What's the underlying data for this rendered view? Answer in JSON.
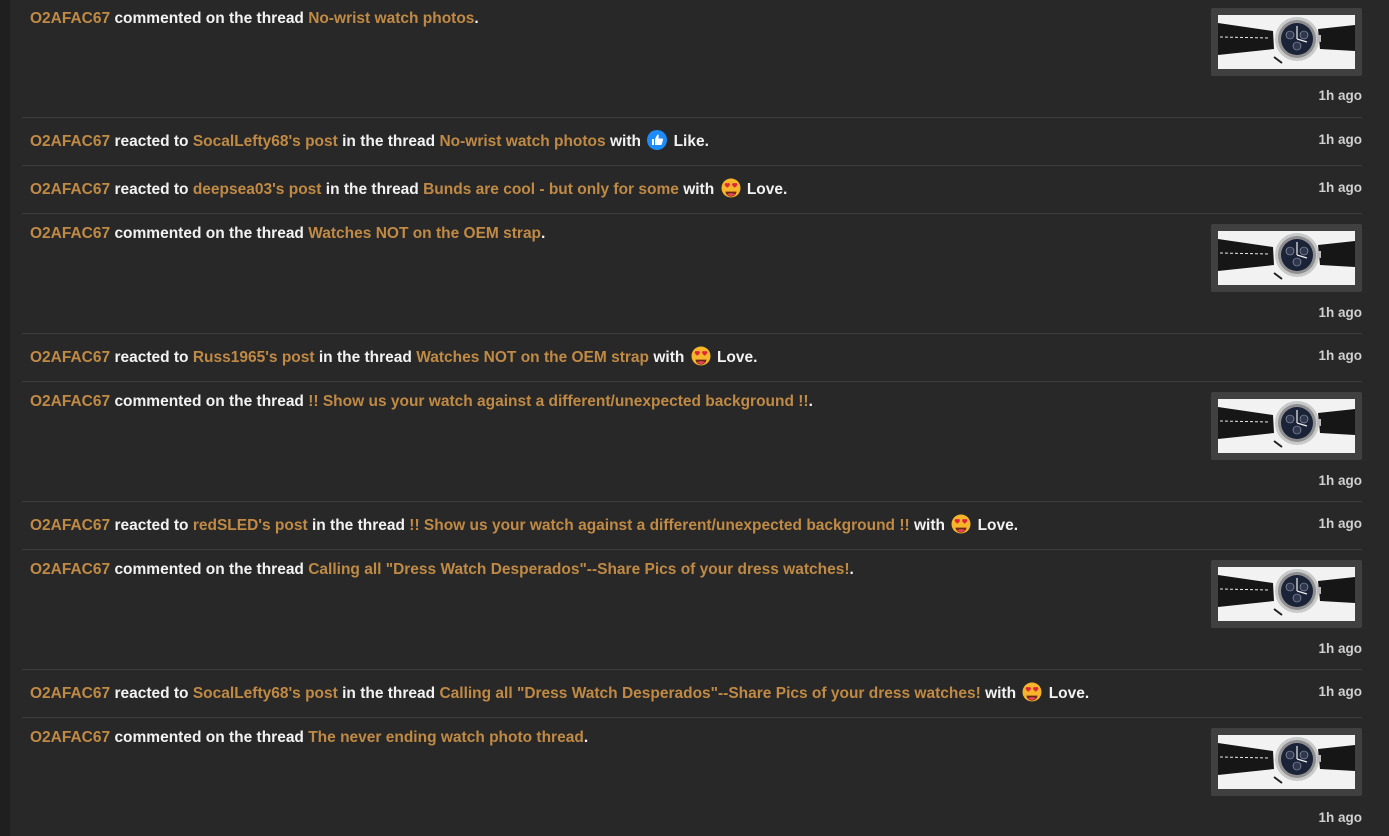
{
  "colors": {
    "background": "#282828",
    "link": "#c08a45",
    "text": "#f2f2f2",
    "divider": "#3c3c3c"
  },
  "items": [
    {
      "user": "O2AFAC67",
      "verb": "commented on the thread",
      "thread": "No-wrist watch photos",
      "end": ".",
      "time": "1h ago",
      "thumb_icon": "watch-photo-thumbnail"
    },
    {
      "user": "O2AFAC67",
      "verb": "reacted to",
      "post": "SocalLefty68's post",
      "mid": "in the thread",
      "thread": "No-wrist watch photos",
      "with": "with",
      "reaction_icon": "like-icon",
      "reaction": "Like.",
      "time": "1h ago"
    },
    {
      "user": "O2AFAC67",
      "verb": "reacted to",
      "post": "deepsea03's post",
      "mid": "in the thread",
      "thread": "Bunds are cool - but only for some",
      "with": "with",
      "reaction_icon": "love-icon",
      "reaction": "Love.",
      "time": "1h ago"
    },
    {
      "user": "O2AFAC67",
      "verb": "commented on the thread",
      "thread": "Watches NOT on the OEM strap",
      "end": ".",
      "time": "1h ago",
      "thumb_icon": "watch-photo-thumbnail"
    },
    {
      "user": "O2AFAC67",
      "verb": "reacted to",
      "post": "Russ1965's post",
      "mid": "in the thread",
      "thread": "Watches NOT on the OEM strap",
      "with": "with",
      "reaction_icon": "love-icon",
      "reaction": "Love.",
      "time": "1h ago"
    },
    {
      "user": "O2AFAC67",
      "verb": "commented on the thread",
      "thread": "!! Show us your watch against a different/unexpected background !!",
      "end": ".",
      "time": "1h ago",
      "thumb_icon": "watch-photo-thumbnail"
    },
    {
      "user": "O2AFAC67",
      "verb": "reacted to",
      "post": "redSLED's post",
      "mid": "in the thread",
      "thread": "!! Show us your watch against a different/unexpected background !!",
      "with": "with",
      "reaction_icon": "love-icon",
      "reaction": "Love.",
      "time": "1h ago"
    },
    {
      "user": "O2AFAC67",
      "verb": "commented on the thread",
      "thread": "Calling all \"Dress Watch Desperados\"--Share Pics of your dress watches!",
      "end": ".",
      "time": "1h ago",
      "thumb_icon": "watch-photo-thumbnail"
    },
    {
      "user": "O2AFAC67",
      "verb": "reacted to",
      "post": "SocalLefty68's post",
      "mid": "in the thread",
      "thread": "Calling all \"Dress Watch Desperados\"--Share Pics of your dress watches!",
      "with": "with",
      "reaction_icon": "love-icon",
      "reaction": "Love.",
      "time": "1h ago"
    },
    {
      "user": "O2AFAC67",
      "verb": "commented on the thread",
      "thread": "The never ending watch photo thread",
      "end": ".",
      "time": "1h ago",
      "thumb_icon": "watch-photo-thumbnail"
    }
  ]
}
